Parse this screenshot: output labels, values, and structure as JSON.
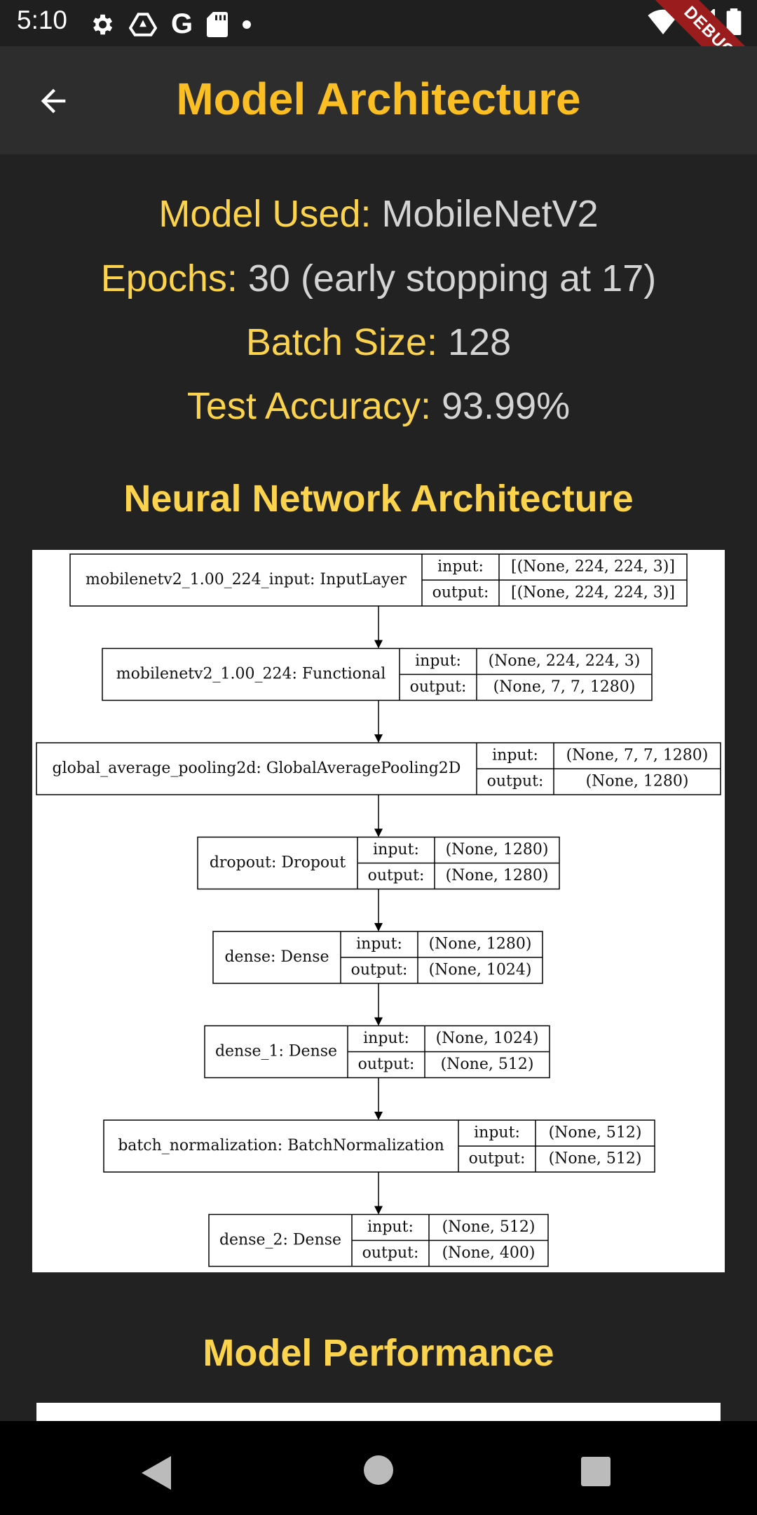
{
  "status_bar": {
    "time": "5:10",
    "debug_label": "DEBUG"
  },
  "app_bar": {
    "title": "Model Architecture"
  },
  "info": {
    "model_key": "Model Used: ",
    "model_val": "MobileNetV2",
    "epochs_key": "Epochs: ",
    "epochs_val": "30 (early stopping at 17)",
    "batch_key": "Batch Size: ",
    "batch_val": "128",
    "acc_key": "Test Accuracy: ",
    "acc_val": "93.99%"
  },
  "sections": {
    "architecture": "Neural Network Architecture",
    "performance": "Model Performance"
  },
  "diagram": {
    "input_label": "input:",
    "output_label": "output:",
    "layers": [
      {
        "name": "mobilenetv2_1.00_224_input: InputLayer",
        "input": "[(None, 224, 224, 3)]",
        "output": "[(None, 224, 224, 3)]"
      },
      {
        "name": "mobilenetv2_1.00_224: Functional",
        "input": "(None, 224, 224, 3)",
        "output": "(None, 7, 7, 1280)"
      },
      {
        "name": "global_average_pooling2d: GlobalAveragePooling2D",
        "input": "(None, 7, 7, 1280)",
        "output": "(None, 1280)"
      },
      {
        "name": "dropout: Dropout",
        "input": "(None, 1280)",
        "output": "(None, 1280)"
      },
      {
        "name": "dense: Dense",
        "input": "(None, 1280)",
        "output": "(None, 1024)"
      },
      {
        "name": "dense_1: Dense",
        "input": "(None, 1024)",
        "output": "(None, 512)"
      },
      {
        "name": "batch_normalization: BatchNormalization",
        "input": "(None, 512)",
        "output": "(None, 512)"
      },
      {
        "name": "dense_2: Dense",
        "input": "(None, 512)",
        "output": "(None, 400)"
      }
    ]
  }
}
